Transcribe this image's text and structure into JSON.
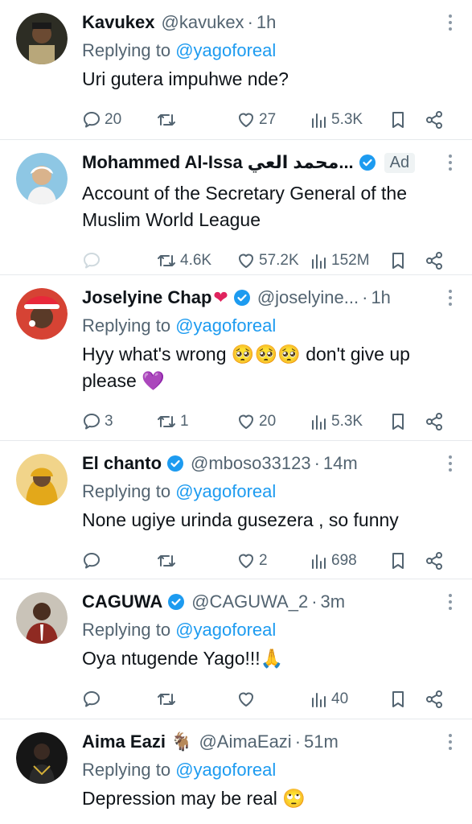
{
  "tweets": [
    {
      "name": "Kavukex",
      "handle": "@kavukex",
      "time": "1h",
      "verified": false,
      "reply_prefix": "Replying to ",
      "reply_to": "@yagoforeal",
      "text": "Uri gutera impuhwe nde?",
      "stats": {
        "replies": "20",
        "retweets": "",
        "likes": "27",
        "views": "5.3K"
      },
      "avatar_color": "#3b3b2f"
    },
    {
      "name": "Mohammed Al-Issa محمد العي...",
      "handle": "",
      "time": "",
      "verified": true,
      "ad_label": "Ad",
      "text": "Account of the Secretary General of the Muslim World League",
      "stats": {
        "replies": "",
        "retweets": "4.6K",
        "likes": "57.2K",
        "views": "152M"
      },
      "avatar_color": "#6fb5d8"
    },
    {
      "name": "Joselyine Chap",
      "handle": "@joselyine...",
      "time": "1h",
      "verified": true,
      "reply_prefix": "Replying to ",
      "reply_to": "@yagoforeal",
      "text": "Hyy what's wrong 🥺🥺🥺 don't give up please 💜",
      "stats": {
        "replies": "3",
        "retweets": "1",
        "likes": "20",
        "views": "5.3K"
      },
      "avatar_color": "#c0392b"
    },
    {
      "name": "El chanto",
      "handle": "@mboso33123",
      "time": "14m",
      "verified": true,
      "reply_prefix": "Replying to ",
      "reply_to": "@yagoforeal",
      "text": "None ugiye urinda gusezera , so funny",
      "stats": {
        "replies": "",
        "retweets": "",
        "likes": "2",
        "views": "698"
      },
      "avatar_color": "#e0b020"
    },
    {
      "name": "CAGUWA",
      "handle": "@CAGUWA_2",
      "time": "3m",
      "verified": true,
      "reply_prefix": "Replying to ",
      "reply_to": "@yagoforeal",
      "text": "Oya ntugende Yago!!!🙏",
      "stats": {
        "replies": "",
        "retweets": "",
        "likes": "",
        "views": "40"
      },
      "avatar_color": "#8a3a2e"
    },
    {
      "name": "Aima Eazi 🐐",
      "handle": "@AimaEazi",
      "time": "51m",
      "verified": false,
      "reply_prefix": "Replying to ",
      "reply_to": "@yagoforeal",
      "text": "Depression may be real 🙄",
      "stats": {
        "replies": "",
        "retweets": "",
        "likes": "",
        "views": ""
      },
      "avatar_color": "#1c1c1c"
    }
  ],
  "colors": {
    "text": "#0f1419",
    "muted": "#536471",
    "link": "#1d9bf0",
    "divider": "#e6e9ec",
    "verified": "#1d9bf0",
    "heart_emoji": "#e0245e"
  },
  "icons": {
    "reply": "reply-icon",
    "retweet": "retweet-icon",
    "like": "like-icon",
    "views": "views-icon",
    "bookmark": "bookmark-icon",
    "share": "share-icon",
    "more": "more-icon",
    "verified": "verified-badge-icon"
  }
}
